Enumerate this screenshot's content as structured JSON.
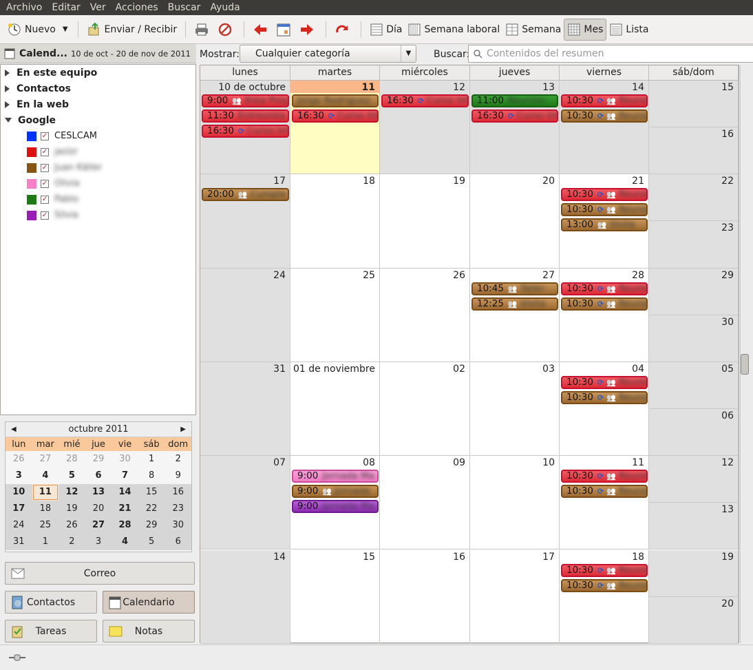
{
  "menu": [
    "Archivo",
    "Editar",
    "Ver",
    "Acciones",
    "Buscar",
    "Ayuda"
  ],
  "toolbar": {
    "new_label": "Nuevo",
    "send_receive_label": "Enviar / Recibir",
    "views": [
      "Día",
      "Semana laboral",
      "Semana",
      "Mes",
      "Lista"
    ],
    "active_view": "Mes"
  },
  "sidebar": {
    "title": "Calend...",
    "range": "10 de oct - 20 de nov de 2011",
    "groups": [
      {
        "label": "En este equipo",
        "open": false
      },
      {
        "label": "Contactos",
        "open": false
      },
      {
        "label": "En la web",
        "open": false
      },
      {
        "label": "Google",
        "open": true
      }
    ],
    "calendars": [
      {
        "name": "CESLCAM",
        "color": "#0033ff",
        "checked": true,
        "blurred": false
      },
      {
        "name": "jaslzr",
        "color": "#dd1111",
        "checked": true,
        "blurred": true
      },
      {
        "name": "Juan Käller",
        "color": "#8a5514",
        "checked": true,
        "blurred": true
      },
      {
        "name": "Olivia",
        "color": "#f77ec8",
        "checked": true,
        "blurred": true
      },
      {
        "name": "Pablo",
        "color": "#1e7a12",
        "checked": true,
        "blurred": true
      },
      {
        "name": "Silvia",
        "color": "#9a1fb5",
        "checked": true,
        "blurred": true
      }
    ]
  },
  "mini_calendar": {
    "month_label": "octubre 2011",
    "weekdays": [
      "lun",
      "mar",
      "mié",
      "jue",
      "vie",
      "sáb",
      "dom"
    ],
    "days": [
      [
        "26",
        "27",
        "28",
        "29",
        "30",
        "1",
        "2"
      ],
      [
        "3",
        "4",
        "5",
        "6",
        "7",
        "8",
        "9"
      ],
      [
        "10",
        "11",
        "12",
        "13",
        "14",
        "15",
        "16"
      ],
      [
        "17",
        "18",
        "19",
        "20",
        "21",
        "22",
        "23"
      ],
      [
        "24",
        "25",
        "26",
        "27",
        "28",
        "29",
        "30"
      ],
      [
        "31",
        "1",
        "2",
        "3",
        "4",
        "5",
        "6"
      ]
    ]
  },
  "nav_buttons": {
    "mail": "Correo",
    "contacts": "Contactos",
    "calendar": "Calendario",
    "tasks": "Tareas",
    "notes": "Notas"
  },
  "filter": {
    "show_label": "Mostrar:",
    "category": "Cualquier categoría",
    "search_label": "Buscar:",
    "search_placeholder": "Contenidos del resumen"
  },
  "month": {
    "headers": [
      "lunes",
      "martes",
      "miércoles",
      "jueves",
      "viernes",
      "sáb/dom"
    ],
    "weeks": [
      {
        "mon": "10 de octubre",
        "tue": "11",
        "wed": "12",
        "thu": "13",
        "fri": "14",
        "sat": "15",
        "sun": "16"
      },
      {
        "mon": "17",
        "tue": "18",
        "wed": "19",
        "thu": "20",
        "fri": "21",
        "sat": "22",
        "sun": "23"
      },
      {
        "mon": "24",
        "tue": "25",
        "wed": "26",
        "thu": "27",
        "fri": "28",
        "sat": "29",
        "sun": "30"
      },
      {
        "mon": "31",
        "tue": "01 de noviembre",
        "wed": "02",
        "thu": "03",
        "fri": "04",
        "sat": "05",
        "sun": "06"
      },
      {
        "mon": "07",
        "tue": "08",
        "wed": "09",
        "thu": "10",
        "fri": "11",
        "sat": "12",
        "sun": "13"
      },
      {
        "mon": "14",
        "tue": "15",
        "wed": "16",
        "thu": "17",
        "fri": "18",
        "sat": "19",
        "sun": "20"
      }
    ],
    "events": [
      {
        "week": 0,
        "day": 0,
        "slot": 0,
        "time": "9:00",
        "color": "red",
        "icon": "people",
        "title": "Area Proy"
      },
      {
        "week": 0,
        "day": 0,
        "slot": 1,
        "time": "11:30",
        "color": "red",
        "icon": "none",
        "title": "Entrevista"
      },
      {
        "week": 0,
        "day": 0,
        "slot": 2,
        "time": "16:30",
        "color": "red",
        "icon": "recur",
        "title": "Curso Inf"
      },
      {
        "week": 0,
        "day": 1,
        "slot": 0,
        "time": "",
        "color": "brown",
        "icon": "none",
        "title": "Jorge Rodriguez"
      },
      {
        "week": 0,
        "day": 1,
        "slot": 1,
        "time": "16:30",
        "color": "red",
        "icon": "recur",
        "title": "Curso Inf"
      },
      {
        "week": 0,
        "day": 2,
        "slot": 0,
        "time": "16:30",
        "color": "red",
        "icon": "recur",
        "title": "Curso Inf"
      },
      {
        "week": 0,
        "day": 3,
        "slot": 0,
        "time": "11:00",
        "color": "green",
        "icon": "none",
        "title": "Reunión"
      },
      {
        "week": 0,
        "day": 3,
        "slot": 1,
        "time": "16:30",
        "color": "red",
        "icon": "recur",
        "title": "Curso Inf"
      },
      {
        "week": 0,
        "day": 4,
        "slot": 0,
        "time": "10:30",
        "color": "red",
        "icon": "recur-people",
        "title": "Reunión"
      },
      {
        "week": 0,
        "day": 4,
        "slot": 1,
        "time": "10:30",
        "color": "brown",
        "icon": "recur-people",
        "title": "Reunión"
      },
      {
        "week": 1,
        "day": 0,
        "slot": 0,
        "time": "20:00",
        "color": "brown",
        "icon": "people",
        "title": "Cumple"
      },
      {
        "week": 1,
        "day": 4,
        "slot": 0,
        "time": "10:30",
        "color": "red",
        "icon": "recur-people",
        "title": "Reunión"
      },
      {
        "week": 1,
        "day": 4,
        "slot": 1,
        "time": "10:30",
        "color": "brown",
        "icon": "recur-people",
        "title": "Reunión"
      },
      {
        "week": 1,
        "day": 4,
        "slot": 2,
        "time": "13:00",
        "color": "brown",
        "icon": "people",
        "title": "Visita"
      },
      {
        "week": 2,
        "day": 3,
        "slot": 0,
        "time": "10:45",
        "color": "brown",
        "icon": "people",
        "title": "Taller"
      },
      {
        "week": 2,
        "day": 3,
        "slot": 1,
        "time": "12:25",
        "color": "brown",
        "icon": "people",
        "title": "Visita"
      },
      {
        "week": 2,
        "day": 4,
        "slot": 0,
        "time": "10:30",
        "color": "red",
        "icon": "recur-people",
        "title": "Reunión"
      },
      {
        "week": 2,
        "day": 4,
        "slot": 1,
        "time": "10:30",
        "color": "brown",
        "icon": "recur-people",
        "title": "Reunión"
      },
      {
        "week": 3,
        "day": 4,
        "slot": 0,
        "time": "10:30",
        "color": "red",
        "icon": "recur-people",
        "title": "Reunión"
      },
      {
        "week": 3,
        "day": 4,
        "slot": 1,
        "time": "10:30",
        "color": "brown",
        "icon": "recur-people",
        "title": "Reunión"
      },
      {
        "week": 4,
        "day": 1,
        "slot": 0,
        "time": "9:00",
        "color": "pink",
        "icon": "none",
        "title": "Jornada Ma"
      },
      {
        "week": 4,
        "day": 1,
        "slot": 1,
        "time": "9:00",
        "color": "brown",
        "icon": "people",
        "title": "Jornada"
      },
      {
        "week": 4,
        "day": 1,
        "slot": 2,
        "time": "9:00",
        "color": "purple",
        "icon": "none",
        "title": "Jornada Ma"
      },
      {
        "week": 4,
        "day": 4,
        "slot": 0,
        "time": "10:30",
        "color": "red",
        "icon": "recur-people",
        "title": "Reunión"
      },
      {
        "week": 4,
        "day": 4,
        "slot": 1,
        "time": "10:30",
        "color": "brown",
        "icon": "recur-people",
        "title": "Reunión"
      },
      {
        "week": 5,
        "day": 4,
        "slot": 0,
        "time": "10:30",
        "color": "red",
        "icon": "recur-people",
        "title": "Reunión"
      },
      {
        "week": 5,
        "day": 4,
        "slot": 1,
        "time": "10:30",
        "color": "brown",
        "icon": "recur-people",
        "title": "Reunión"
      }
    ]
  }
}
